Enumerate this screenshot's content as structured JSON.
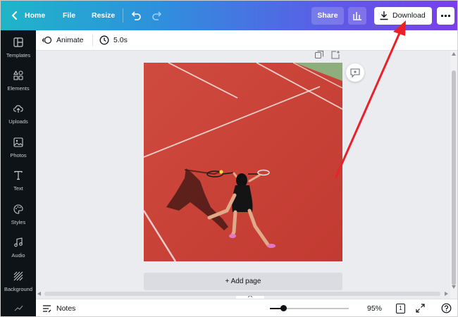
{
  "topbar": {
    "home_label": "Home",
    "file_label": "File",
    "resize_label": "Resize",
    "share_label": "Share",
    "download_label": "Download"
  },
  "sidebar": {
    "items": [
      {
        "label": "Templates",
        "icon": "templates-icon"
      },
      {
        "label": "Elements",
        "icon": "elements-icon"
      },
      {
        "label": "Uploads",
        "icon": "upload-cloud-icon"
      },
      {
        "label": "Photos",
        "icon": "image-icon"
      },
      {
        "label": "Text",
        "icon": "text-icon"
      },
      {
        "label": "Styles",
        "icon": "palette-icon"
      },
      {
        "label": "Audio",
        "icon": "music-note-icon"
      },
      {
        "label": "Background",
        "icon": "background-hatch-icon"
      }
    ]
  },
  "toolbar": {
    "animate_label": "Animate",
    "duration": "5.0s"
  },
  "canvas": {
    "add_page_label": "+ Add page",
    "photo_subject": "tennis-player-on-clay-court"
  },
  "bottombar": {
    "notes_label": "Notes",
    "zoom_label": "95%",
    "zoom_fraction": 0.17,
    "page_count": "1"
  },
  "colors": {
    "accent_arrow": "#e8212a",
    "sidebar_bg": "#0e1318",
    "court_red": "#c9463c"
  }
}
